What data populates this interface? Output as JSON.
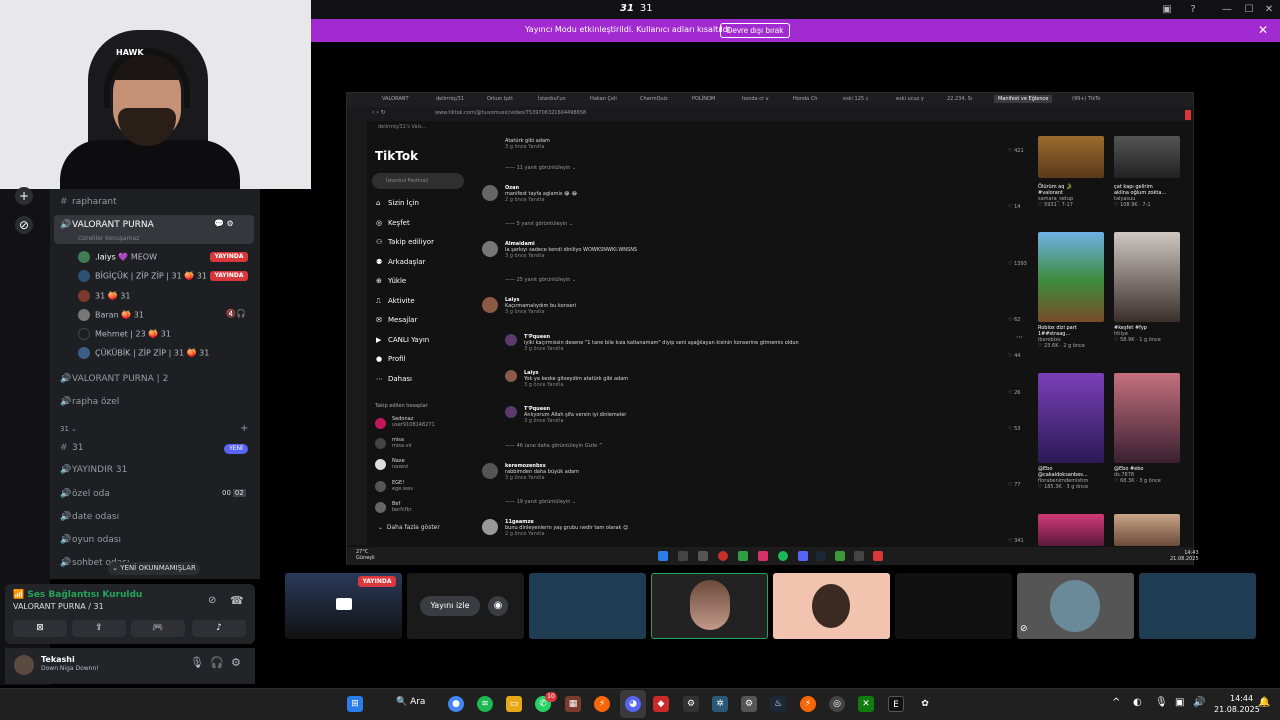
{
  "title_center": "31",
  "title_icon": "31",
  "streamer": {
    "message": "Yayıncı Modu etkinleştirildi. Kullanıcı adları kısaltıldı.",
    "button": "Devre dışı bırak"
  },
  "webcam": {
    "logo": "HAWK"
  },
  "channels": {
    "items": [
      {
        "icon": "#",
        "name": "rapharant"
      },
      {
        "icon": "🔊",
        "name": "VALORANT PURNA"
      },
      {
        "icon": "🔊",
        "name": "VALORANT PURNA | 2"
      },
      {
        "icon": "🔊",
        "name": "rapha özel"
      },
      {
        "icon": "#",
        "name": "31"
      },
      {
        "icon": "🔊",
        "name": "YAYINDIR 31"
      },
      {
        "icon": "🔊",
        "name": "özel oda"
      },
      {
        "icon": "🔊",
        "name": "date odası"
      },
      {
        "icon": "🔊",
        "name": "oyun odası"
      },
      {
        "icon": "🔊",
        "name": "sohbet odası"
      }
    ],
    "voice_subtitle": "cizreliler konuşamaz",
    "category": "31",
    "new_badge": "YENİ",
    "ozel_count_a": "00",
    "ozel_count_b": "02",
    "voice_users": [
      {
        "name": ".laiys",
        "extra": "💜 MEOW",
        "live": "YAYINDA"
      },
      {
        "name": "BİGİÇÜK | ZİP ZİP | 31",
        "extra": "🍑 31",
        "live": "YAYINDA"
      },
      {
        "name": "31",
        "extra": "🍑 31",
        "live": ""
      },
      {
        "name": "Baran",
        "extra": "🍑 31",
        "live": ""
      },
      {
        "name": "Mehmet | 23",
        "extra": "🍑 31",
        "live": ""
      },
      {
        "name": "ÇÜKÜBİK | ZİP ZİP | 31",
        "extra": "🍑 31",
        "live": ""
      }
    ],
    "unread_pill": "YENİ OKUNMAMIŞLAR"
  },
  "voice_panel": {
    "status": "Ses Bağlantısı Kuruldu",
    "channel": "VALORANT PURNA / 31"
  },
  "user_panel": {
    "name": "Tekashi",
    "status": "Down Niga Downn!"
  },
  "browser": {
    "tabs": [
      "VALORANT",
      "delirmiş/31",
      "Orkun Işıtt",
      "İstanbul'un",
      "Hakan Çeli",
      "CharmQuiz",
      "POLİNOM",
      "honda cr v",
      "Honda Ch",
      "eski 125 c",
      "eski ucuz y",
      "22.234, Sı",
      "Manifest ve Eğlence",
      "(99+) TikTo"
    ],
    "url": "www.tiktok.com/@huvomusic/video/7539706321604498658",
    "bookmarks": "delirmiş/31's Vals..."
  },
  "tiktok": {
    "logo": "TikTok",
    "search_placeholder": "İstanbul Festivali",
    "nav": [
      "Sizin İçin",
      "Keşfet",
      "Takip ediliyor",
      "Arkadaşlar",
      "Yükle",
      "Aktivite",
      "Mesajlar",
      "CANLI Yayın",
      "Profil",
      "Dahası"
    ],
    "follow_title": "Takip edilen hesaplar",
    "following": [
      {
        "name": "Sedonaz",
        "handle": "user9108148271"
      },
      {
        "name": "misa",
        "handle": "misa.vir"
      },
      {
        "name": "Naxe",
        "handle": "naxevi"
      },
      {
        "name": "EGE!",
        "handle": "ege.wav"
      },
      {
        "name": "Bef",
        "handle": "berfcfkr"
      }
    ],
    "more": "Daha fazla göster"
  },
  "comments": [
    {
      "name": "",
      "text": "Atatürk gibi adam",
      "meta": "3 g önce   Yanıtla",
      "likes": "421"
    },
    {
      "name": "",
      "text": "11 yanıt görüntüleyin",
      "meta": "",
      "likes": ""
    },
    {
      "name": "Ozan",
      "text": "manifest tayfa aglamis 😂 😂",
      "meta": "2 g önce   Yanıtla",
      "likes": "14"
    },
    {
      "name": "",
      "text": "5 yanıt görüntüleyin",
      "meta": "",
      "likes": ""
    },
    {
      "name": "Almaidami",
      "text": "Ia şarkıyı sadece kendi diniliyo WOWKSNWKI.WNSNS",
      "meta": "3 g önce   Yanıtla",
      "likes": "1393"
    },
    {
      "name": "",
      "text": "25 yanıt görüntüleyin",
      "meta": "",
      "likes": ""
    },
    {
      "name": "Laiys",
      "text": "Kaçırmamalıydım bu konseri",
      "meta": "3 g önce   Yanıtla",
      "likes": "62"
    },
    {
      "name": "T'Pqueen",
      "text": "iyiki kaçırmissin desene \"1 tane bile kıza katlanamam\" diyip seni aşağılayan kisinin konserine gitmemis oldun",
      "meta": "3 g önce   Yanıtla",
      "likes": "44"
    },
    {
      "name": "Laiys",
      "text": "Yok ya keske gitseydim atatürk gibi adam",
      "meta": "3 g önce   Yanıtla",
      "likes": "26"
    },
    {
      "name": "T'Pqueen",
      "text": "Anlıyorum Allah şifa versin iyi dinlemeler",
      "meta": "3 g önce   Yanıtla",
      "likes": "53"
    },
    {
      "name": "",
      "text": "46 tane daha görüntüleyin   Gizle ^",
      "meta": "",
      "likes": ""
    },
    {
      "name": "keremozenbxs",
      "text": "rabbimden daha büyük adam",
      "meta": "3 g önce   Yanıtla",
      "likes": "77"
    },
    {
      "name": "",
      "text": "19 yanıt görüntüleyin",
      "meta": "",
      "likes": ""
    },
    {
      "name": "11gaamze",
      "text": "bunu dinleyenlerin yaş grubu nedir tam olarak 😊",
      "meta": "2 g önce   Yanıtla",
      "likes": "341"
    }
  ],
  "thumbs": [
    {
      "cap": "Ölürüm aq 🐊",
      "sub": "#valorant",
      "user": "samara_setup",
      "stats": "♡ 5931 · 7-17"
    },
    {
      "cap": "çat kapı gelirim",
      "sub": "aklina oğlum zokta...",
      "user": "talyasuu",
      "stats": "♡ 108.9K · 7-1"
    },
    {
      "cap": "Roblox dizi part",
      "sub": "1##straag...",
      "user": "ibxroblxs",
      "stats": "♡ 23.6K · 2 g önce"
    },
    {
      "cap": "#keşfet #fyp",
      "sub": "",
      "user": "htilye",
      "stats": "♡ 58.9K · 1 g önce"
    },
    {
      "cap": "@Ebo",
      "sub": "@cakaldoksanbes...",
      "user": "florabenimdemistim",
      "stats": "♡ 185.3K · 3 g önce"
    },
    {
      "cap": "@Ebo #ebo",
      "sub": "",
      "user": "ds.7878",
      "stats": "♡ 68.3K · 3 g önce"
    }
  ],
  "inner_taskbar": {
    "weather": "27°C",
    "weather_sub": "Güneşli",
    "time": "14:43",
    "date": "21.08.2025"
  },
  "tiles": {
    "live": "YAYINDA",
    "watch": "Yayını izle"
  },
  "taskbar": {
    "search": "Ara",
    "time": "14:44",
    "date": "21.08.2025",
    "whatsapp_badge": "10"
  },
  "colors": {
    "streamer_bar": "#a12ad0",
    "live_red": "#da373c",
    "connected_green": "#23a55a",
    "blurple": "#5865f2"
  }
}
